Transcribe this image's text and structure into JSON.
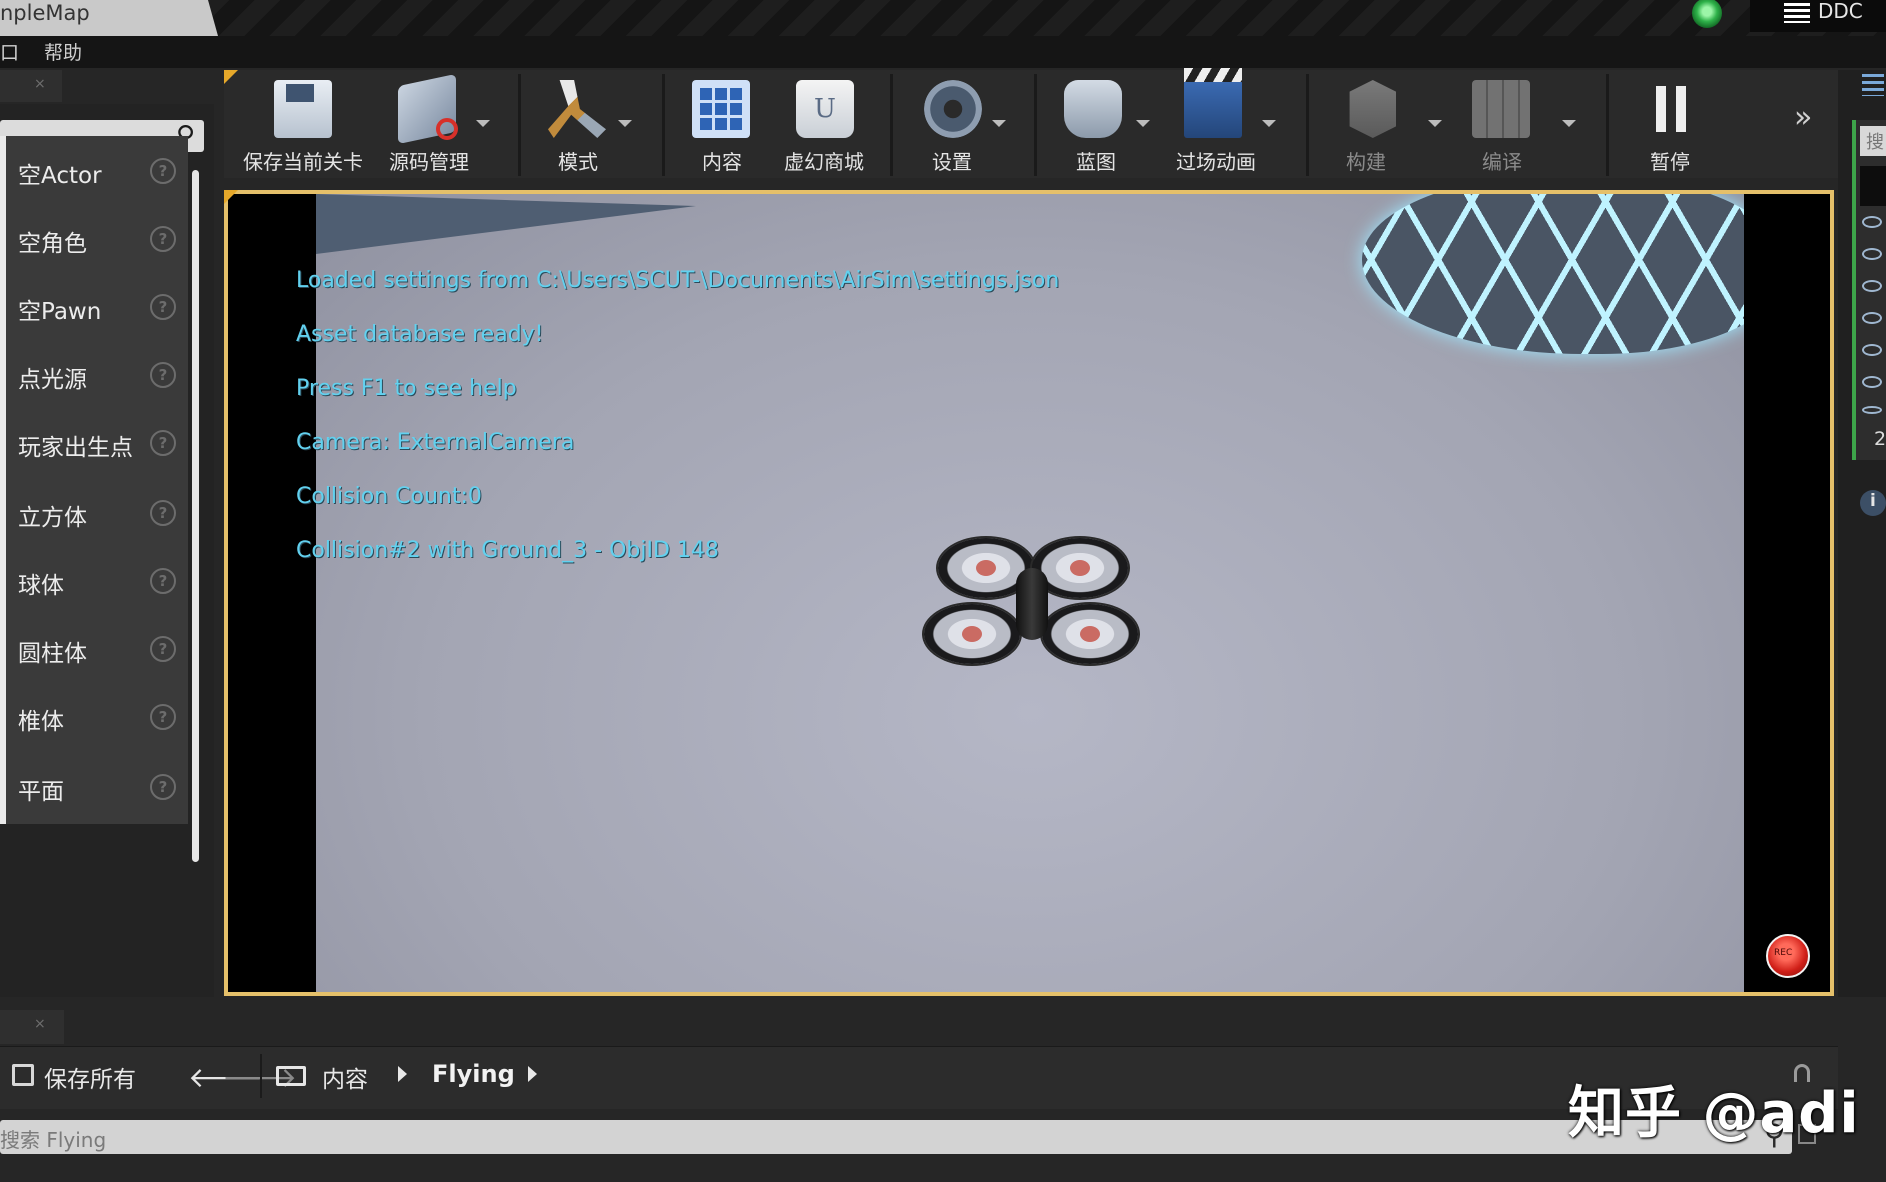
{
  "window": {
    "title": "npleMap",
    "ddc_label": "DDC"
  },
  "menu": {
    "fragment": "口",
    "help": "帮助"
  },
  "place_panel": {
    "tab_close": "×",
    "search_placeholder": "",
    "items": [
      {
        "label": "空Actor",
        "help": "?"
      },
      {
        "label": "空角色",
        "help": "?"
      },
      {
        "label": "空Pawn",
        "help": "?"
      },
      {
        "label": "点光源",
        "help": "?"
      },
      {
        "label": "玩家出生点",
        "help": "?"
      },
      {
        "label": "立方体",
        "help": "?"
      },
      {
        "label": "球体",
        "help": "?"
      },
      {
        "label": "圆柱体",
        "help": "?"
      },
      {
        "label": "椎体",
        "help": "?"
      },
      {
        "label": "平面",
        "help": "?"
      }
    ]
  },
  "toolbar": {
    "save_level": "保存当前关卡",
    "source_control": "源码管理",
    "modes": "模式",
    "content": "内容",
    "marketplace": "虚幻商城",
    "settings": "设置",
    "blueprints": "蓝图",
    "cinematics": "过场动画",
    "build": "构建",
    "compile": "编译",
    "pause": "暂停",
    "more": "»"
  },
  "viewport": {
    "messages": [
      "Loaded settings from C:\\Users\\SCUT-\\Documents\\AirSim\\settings.json",
      "Asset database ready!",
      "Press F1 to see help",
      "Camera: ExternalCamera",
      "Collision Count:0",
      "Collision#2 with Ground_3 - ObjID 148"
    ],
    "rec_label": "REC"
  },
  "right_panel": {
    "search_fragment": "搜",
    "number_fragment": "2",
    "info": "i"
  },
  "content_browser": {
    "tab_close": "×",
    "save_all": "保存所有",
    "back": "🡐",
    "forward": "🡒",
    "breadcrumb": [
      "内容",
      "Flying"
    ],
    "search_placeholder": "搜索 Flying",
    "search_icon": "⚲"
  },
  "watermark": "知乎 @adi",
  "colors": {
    "overlay_text": "#62d1ef",
    "viewport_border": "#e5c06a",
    "accent": "#e6a82a",
    "rec": "#d01f18"
  }
}
